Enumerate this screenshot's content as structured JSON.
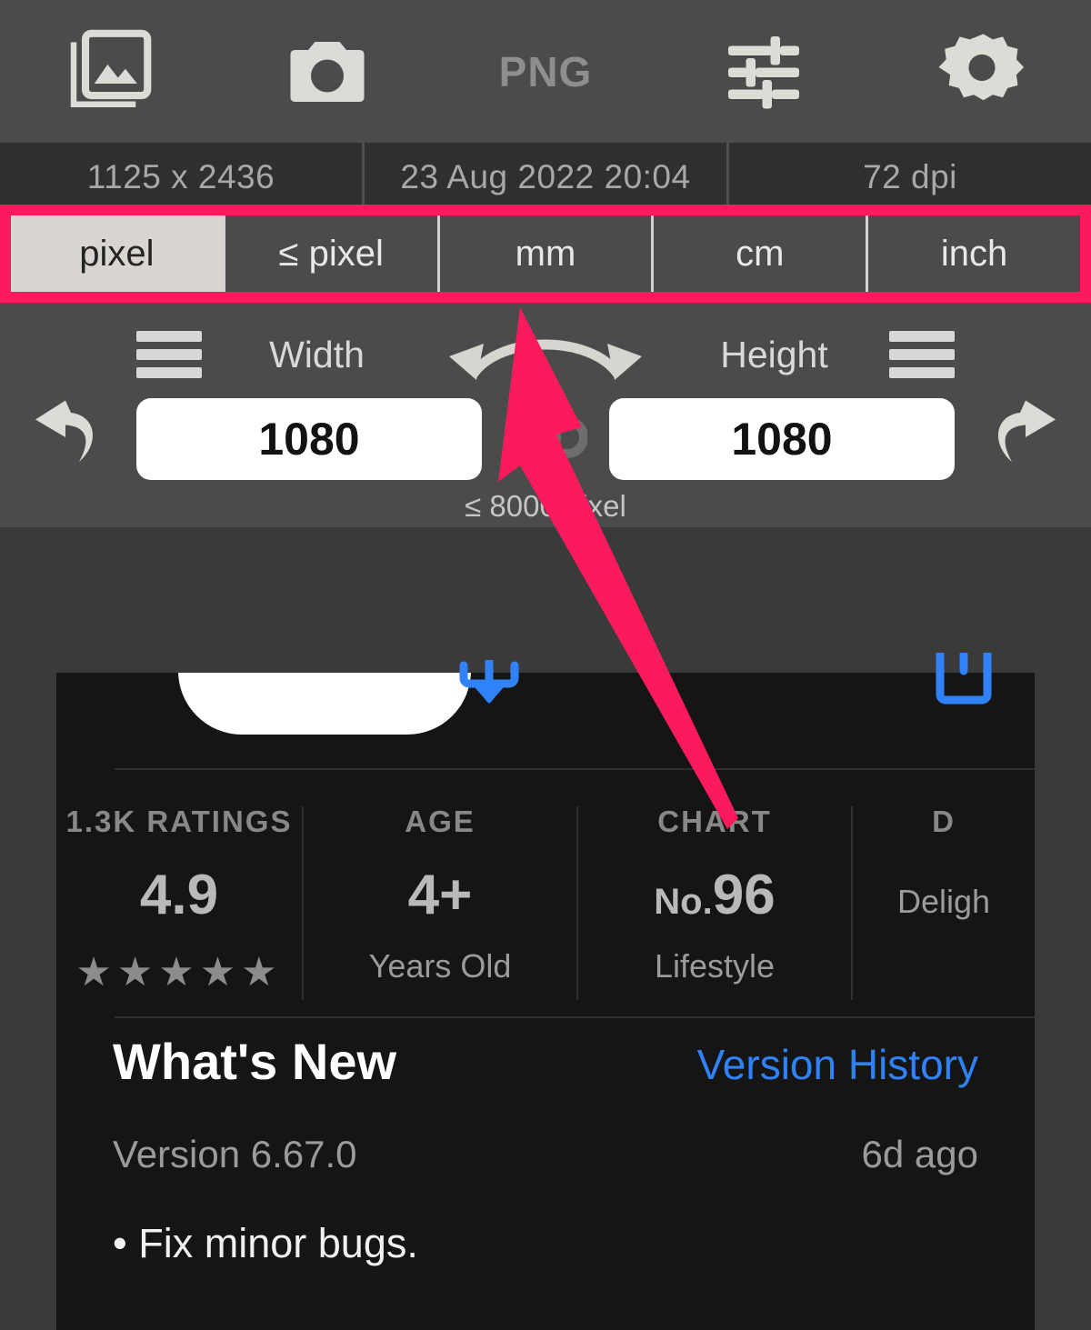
{
  "toolbar": {
    "items": [
      {
        "name": "photo-library-icon",
        "label": ""
      },
      {
        "name": "camera-icon",
        "label": ""
      },
      {
        "name": "png-format-label",
        "label": "PNG"
      },
      {
        "name": "adjustments-icon",
        "label": ""
      },
      {
        "name": "gear-icon",
        "label": ""
      }
    ],
    "png_label": "PNG"
  },
  "info": {
    "dimensions": "1125 x 2436",
    "datetime": "23 Aug 2022 20:04",
    "dpi": "72 dpi"
  },
  "units": {
    "tabs": [
      {
        "label": "pixel",
        "selected": true
      },
      {
        "label": "≤ pixel",
        "selected": false
      },
      {
        "label": "mm",
        "selected": false
      },
      {
        "label": "cm",
        "selected": false
      },
      {
        "label": "inch",
        "selected": false
      }
    ],
    "highlight_color": "#fb1a5b"
  },
  "size": {
    "width_label": "Width",
    "height_label": "Height",
    "width_value": "1080",
    "height_value": "1080",
    "width_placeholder": "1080",
    "height_placeholder": "1080",
    "limit_note": "≤ 8000 pixel",
    "undo_icon": "undo-icon",
    "redo_icon": "redo-icon",
    "swap_icon": "swap-arrows-icon",
    "link_icon": "chain-link-icon",
    "width_menu_icon": "hamburger-icon",
    "height_menu_icon": "hamburger-icon"
  },
  "preview": {
    "get_icon": "download-get-icon",
    "share_icon": "share-icon",
    "stats": [
      {
        "caption": "1.3K RATINGS",
        "value": "4.9",
        "sub": "★★★★★",
        "sub_is_stars": true
      },
      {
        "caption": "AGE",
        "value": "4+",
        "sub": "Years Old",
        "sub_is_stars": false
      },
      {
        "caption": "CHART",
        "value_prefix": "No.",
        "value": "96",
        "sub": "Lifestyle",
        "sub_is_stars": false
      },
      {
        "caption": "D",
        "value": "",
        "sub": "Deligh",
        "sub_is_stars": false
      }
    ],
    "whats_new": {
      "title": "What's New",
      "link": "Version History",
      "version": "Version 6.67.0",
      "ago": "6d ago",
      "note": "• Fix minor bugs."
    }
  },
  "annotation": {
    "arrow_color": "#fb1a5b",
    "arrow_name": "pink-pointer-arrow"
  }
}
